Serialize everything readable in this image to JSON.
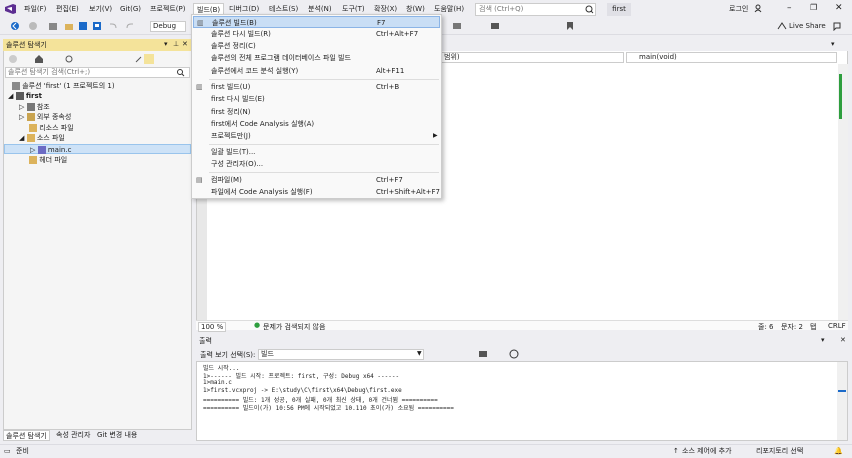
{
  "menubar": {
    "items": [
      "파일(F)",
      "편집(E)",
      "보기(V)",
      "Git(G)",
      "프로젝트(P)",
      "빌드(B)",
      "디버그(D)",
      "테스트(S)",
      "분석(N)",
      "도구(T)",
      "확장(X)",
      "창(W)",
      "도움말(H)"
    ],
    "search_placeholder": "검색 (Ctrl+Q)",
    "solution_name": "first",
    "login": "로그인",
    "live_share": "Live Share"
  },
  "toolbar": {
    "config": "Debug"
  },
  "solution_explorer": {
    "title": "솔루션 탐색기",
    "search_placeholder": "솔루션 탐색기 검색(Ctrl+;)",
    "tree": [
      "솔루션 'first' (1 프로젝트의 1)",
      "first",
      "참조",
      "외부 종속성",
      "리소스 파일",
      "소스 파일",
      "main.c",
      "헤더 파일"
    ],
    "tabs": [
      "솔루션 탐색기",
      "속성 관리자",
      "Git 변경 내용"
    ]
  },
  "editor": {
    "nav_value": "범위)",
    "func_value": "main(void)",
    "zoom": "100 %",
    "issues": "문제가 검색되지 않음",
    "line": "줄: 6",
    "col": "문자: 2",
    "tab": "탭",
    "eol": "CRLF"
  },
  "output": {
    "title": "출력",
    "show_label": "출력 보기 선택(S):",
    "source": "빌드",
    "lines": [
      "빌드 시작...",
      "1>------ 빌드 시작: 프로젝트: first, 구성: Debug x64 ------",
      "1>main.c",
      "1>first.vcxproj -> E:\\study\\C\\first\\x64\\Debug\\first.exe",
      "========== 빌드: 1개 성공, 0개 실패, 0개 최신 상태, 0개 건너뜀 ==========",
      "========== 빌드이(가) 10:56 PM에 시작되었고 10.110 초이(가) 소요됨 =========="
    ]
  },
  "statusbar": {
    "ready": "준비",
    "source_control": "소스 제어에 추가",
    "repo": "리포지토리 선택"
  },
  "build_menu": {
    "items": [
      {
        "label": "솔루션 빌드(B)",
        "key": "F7",
        "icon": "build-solution-icon"
      },
      {
        "label": "솔루션 다시 빌드(R)",
        "key": "Ctrl+Alt+F7"
      },
      {
        "label": "솔루션 정리(C)",
        "key": ""
      },
      {
        "label": "솔루션의 전체 프로그램 데이터베이스 파일 빌드",
        "key": ""
      },
      {
        "label": "솔루션에서 코드 분석 실행(Y)",
        "key": "Alt+F11"
      },
      {
        "label": "first 빌드(U)",
        "key": "Ctrl+B",
        "icon": "build-project-icon"
      },
      {
        "label": "first 다시 빌드(E)",
        "key": ""
      },
      {
        "label": "first 정리(N)",
        "key": ""
      },
      {
        "label": "first에서 Code Analysis 실행(A)",
        "key": ""
      },
      {
        "label": "프로젝트만(J)",
        "key": "",
        "submenu": true
      },
      {
        "label": "일괄 빌드(T)...",
        "key": ""
      },
      {
        "label": "구성 관리자(O)...",
        "key": ""
      },
      {
        "label": "컴파일(M)",
        "key": "Ctrl+F7",
        "icon": "compile-icon"
      },
      {
        "label": "파일에서 Code Analysis 실행(F)",
        "key": "Ctrl+Shift+Alt+F7"
      }
    ]
  }
}
